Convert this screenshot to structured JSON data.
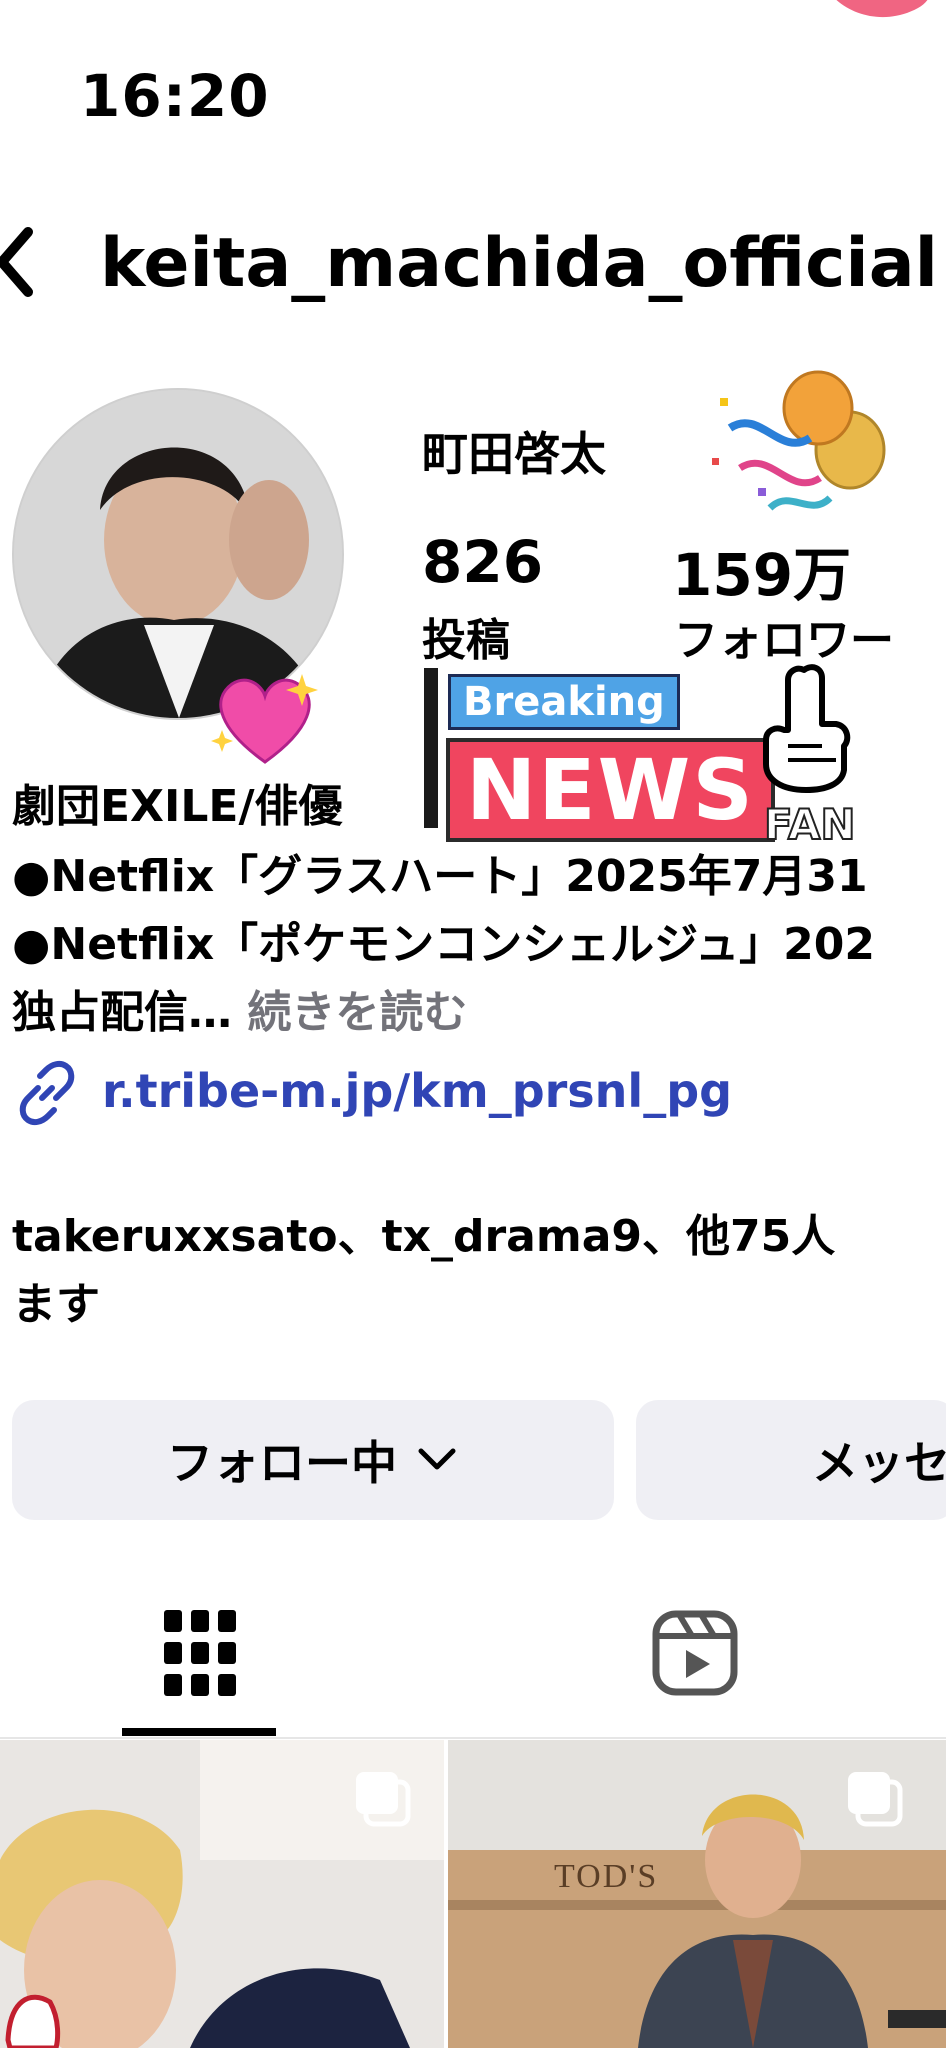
{
  "status_bar": {
    "time": "16:20"
  },
  "header": {
    "username": "keita_machida_official"
  },
  "profile": {
    "display_name": "町田啓太",
    "stats": [
      {
        "value": "826",
        "label": "投稿"
      },
      {
        "value": "159万",
        "label": "フォロワー"
      }
    ],
    "bio": {
      "line1": "劇団EXILE/俳優",
      "line2": "●Netflix「グラスハート」2025年7月31",
      "line3": "●Netflix「ポケモンコンシェルジュ」202",
      "line4": "独占配信…",
      "more": "続きを読む"
    },
    "link": "r.tribe-m.jp/km_prsnl_pg",
    "followed_by_line1": "takeruxxsato、tx_drama9、他75人",
    "followed_by_line2": "ます"
  },
  "buttons": {
    "following": "フォロー中",
    "message": "メッセ"
  },
  "stickers": {
    "breaking": "Breaking",
    "news": "NEWS",
    "fan": "FAN"
  },
  "tabs": [
    {
      "name": "grid",
      "icon": "grid-icon",
      "active": true
    },
    {
      "name": "reels",
      "icon": "reels-icon",
      "active": false
    }
  ],
  "posts": [
    {
      "store_sign": ""
    },
    {
      "store_sign": "TOD'S"
    }
  ],
  "colors": {
    "link": "#3045b5",
    "button_bg": "#efeff4",
    "more_text": "#73737a"
  }
}
